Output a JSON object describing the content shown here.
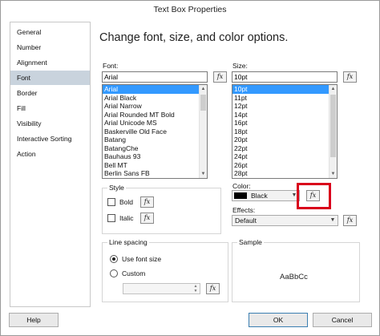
{
  "window": {
    "title": "Text Box Properties"
  },
  "nav": {
    "items": [
      {
        "label": "General"
      },
      {
        "label": "Number"
      },
      {
        "label": "Alignment"
      },
      {
        "label": "Font",
        "selected": true
      },
      {
        "label": "Border"
      },
      {
        "label": "Fill"
      },
      {
        "label": "Visibility"
      },
      {
        "label": "Interactive Sorting"
      },
      {
        "label": "Action"
      }
    ]
  },
  "main": {
    "heading": "Change font, size, and color options.",
    "font": {
      "label": "Font:",
      "value": "Arial",
      "list": [
        "Arial",
        "Arial Black",
        "Arial Narrow",
        "Arial Rounded MT Bold",
        "Arial Unicode MS",
        "Baskerville Old Face",
        "Batang",
        "BatangChe",
        "Bauhaus 93",
        "Bell MT",
        "Berlin Sans FB"
      ],
      "selected": "Arial"
    },
    "size": {
      "label": "Size:",
      "value": "10pt",
      "list": [
        "10pt",
        "11pt",
        "12pt",
        "14pt",
        "16pt",
        "18pt",
        "20pt",
        "22pt",
        "24pt",
        "26pt",
        "28pt"
      ],
      "selected": "10pt"
    },
    "fx_symbol": "fx",
    "style": {
      "title": "Style",
      "bold_label": "Bold",
      "italic_label": "Italic"
    },
    "color": {
      "label": "Color:",
      "value": "Black",
      "swatch": "#000000"
    },
    "effects": {
      "label": "Effects:",
      "value": "Default"
    },
    "line_spacing": {
      "title": "Line spacing",
      "use_font_size_label": "Use font size",
      "custom_label": "Custom",
      "selected": "Use font size"
    },
    "sample": {
      "title": "Sample",
      "text": "AaBbCc"
    },
    "highlight_color": "#d9001b"
  },
  "footer": {
    "help_label": "Help",
    "ok_label": "OK",
    "cancel_label": "Cancel"
  }
}
